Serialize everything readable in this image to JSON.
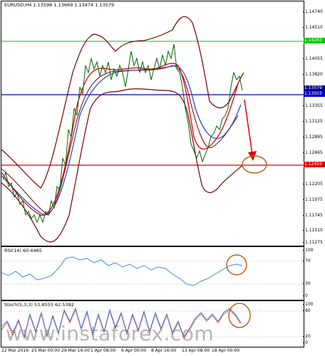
{
  "main": {
    "symbol_label": "EURUSD,H4  1.13598  1.13669  1.13474  1.13579",
    "price_ticks": [
      "1.14740",
      "1.14510",
      "1.14283",
      "1.14055",
      "1.13820",
      "1.13579",
      "1.13503",
      "1.13355",
      "1.13125",
      "1.12895",
      "1.12665",
      "1.12459",
      "1.12205",
      "1.11975",
      "1.11745",
      "1.11510",
      "1.11275"
    ],
    "level_green": {
      "value": "1.14283",
      "color": "#00c800"
    },
    "level_blue": {
      "value": "1.13503",
      "color": "#0000c8"
    },
    "level_red": {
      "value": "1.12459",
      "color": "#e00000"
    },
    "price_tag": {
      "value": "1.13579",
      "color": "#00008b"
    }
  },
  "rsi": {
    "label": "RSI(14) 60.4465",
    "ticks": [
      "100",
      "70",
      "30",
      "0"
    ]
  },
  "stoch": {
    "label": "Stoch(5,3,3) 53.8555 62.5392",
    "ticks": [
      "100",
      "80",
      "20",
      "0"
    ]
  },
  "xaxis": {
    "labels": [
      "22 Mar 2016",
      "25 Mar 00:00",
      "29 Mar 16:00",
      "1 Apr 08:00",
      "6 Apr 00:00",
      "8 Apr 16:00",
      "13 Apr 08:00",
      "18 Apr 00:00"
    ]
  },
  "watermark": "www.instaforex.com"
}
